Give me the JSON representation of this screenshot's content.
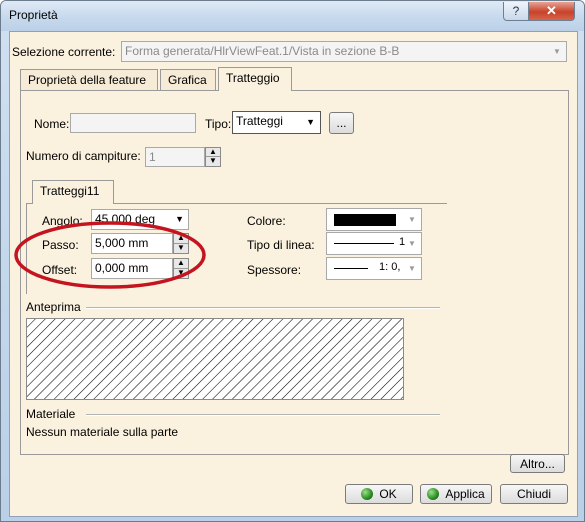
{
  "window": {
    "title": "Proprietà",
    "help_label": "?",
    "close_label": "✕"
  },
  "selection": {
    "label": "Selezione corrente:",
    "value": "Forma generata/HlrViewFeat.1/Vista in sezione B-B"
  },
  "tabs": [
    {
      "label": "Proprietà della feature"
    },
    {
      "label": "Grafica"
    },
    {
      "label": "Tratteggio"
    }
  ],
  "form": {
    "nome_label": "Nome:",
    "nome_value": "",
    "tipo_label": "Tipo:",
    "tipo_value": "Tratteggi",
    "tipo_browse_label": "...",
    "num_campiture_label": "Numero di campiture:",
    "num_campiture_value": "1"
  },
  "subtab": {
    "label": "Tratteggi11"
  },
  "hatch": {
    "angolo_label": "Angolo:",
    "angolo_value": "45,000 deg",
    "passo_label": "Passo:",
    "passo_value": "5,000 mm",
    "offset_label": "Offset:",
    "offset_value": "0,000 mm",
    "colore_label": "Colore:",
    "colore_value": "#000000",
    "tipo_linea_label": "Tipo di linea:",
    "tipo_linea_value": "1",
    "spessore_label": "Spessore:",
    "spessore_value": "1: 0,"
  },
  "preview": {
    "label": "Anteprima"
  },
  "material": {
    "label": "Materiale",
    "value": "Nessun materiale sulla parte"
  },
  "buttons": {
    "altro": "Altro...",
    "ok": "OK",
    "applica": "Applica",
    "chiudi": "Chiudi"
  },
  "colors": {
    "annotation_circle": "#c41420",
    "panel_bg": "#fbf1df",
    "title_bg": "#c5d8ec"
  },
  "icons": {
    "ok_button": "green-dot-icon",
    "applica_button": "green-dot-icon",
    "dropdown": "chevron-down-icon",
    "spin": "spin-arrows-icon"
  }
}
